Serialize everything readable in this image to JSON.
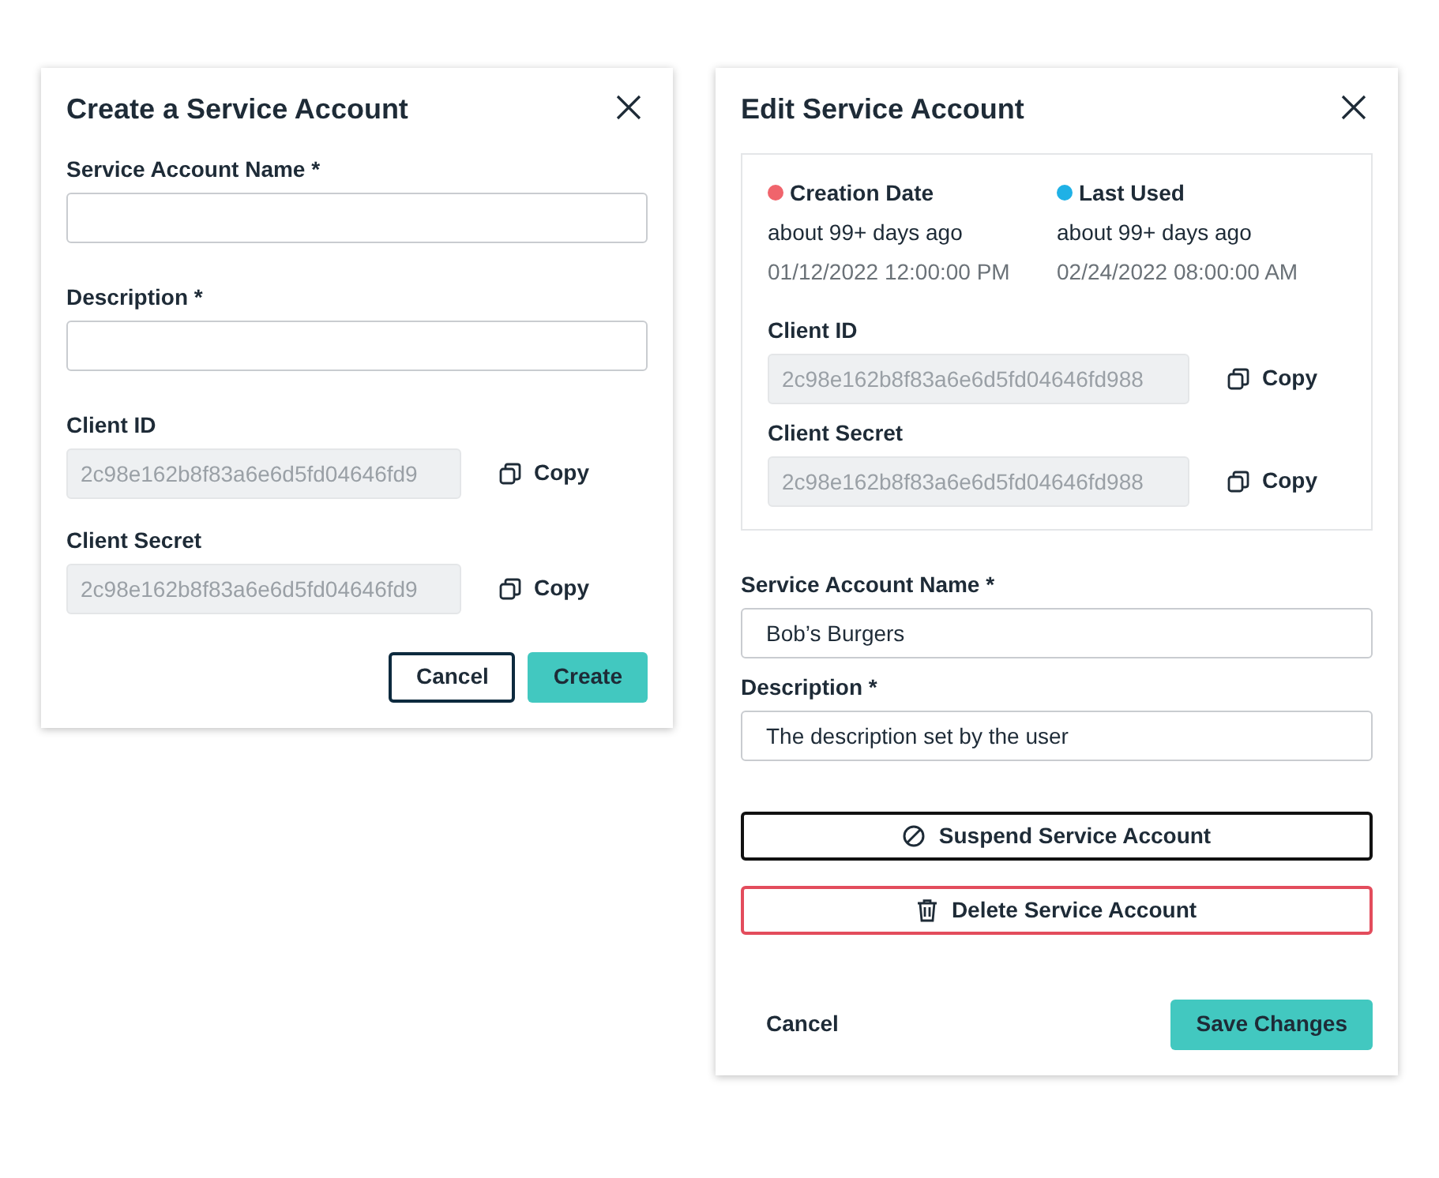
{
  "create_dialog": {
    "title": "Create a Service Account",
    "fields": [
      {
        "kind": "input",
        "label": "Service Account Name *"
      },
      {
        "kind": "input",
        "label": "Description *"
      },
      {
        "kind": "copy",
        "label": "Client ID",
        "value": "2c98e162b8f83a6e6d5fd04646fd9",
        "copy_label": "Copy"
      },
      {
        "kind": "copy",
        "label": "Client Secret",
        "value": "2c98e162b8f83a6e6d5fd04646fd9",
        "copy_label": "Copy"
      }
    ],
    "buttons": [
      {
        "kind": "outline",
        "label": "Cancel"
      },
      {
        "kind": "primary",
        "label": "Create"
      }
    ]
  },
  "edit_dialog": {
    "title": "Edit Service Account",
    "stats": [
      {
        "label": "Creation Date",
        "color": "#f0646c",
        "relative": "about 99+ days ago",
        "date": "01/12/2022 12:00:00 PM"
      },
      {
        "label": "Last Used",
        "color": "#1fb1e6",
        "relative": "about 99+ days ago",
        "date": "02/24/2022 08:00:00 AM"
      }
    ],
    "credentials": [
      {
        "kind": "copy",
        "label": "Client ID",
        "value": "2c98e162b8f83a6e6d5fd04646fd988",
        "copy_label": "Copy"
      },
      {
        "kind": "copy",
        "label": "Client Secret",
        "value": "2c98e162b8f83a6e6d5fd04646fd988",
        "copy_label": "Copy"
      }
    ],
    "fields": [
      {
        "kind": "input",
        "label": "Service Account Name *",
        "value": "Bob’s Burgers"
      },
      {
        "kind": "input",
        "label": "Description *",
        "value": "The description set by the user"
      }
    ],
    "actions": [
      {
        "kind": "suspend",
        "label": "Suspend Service Account"
      },
      {
        "kind": "delete",
        "label": "Delete Service Account"
      }
    ],
    "buttons": [
      {
        "kind": "link",
        "label": "Cancel"
      },
      {
        "kind": "primary",
        "label": "Save Changes"
      }
    ]
  }
}
